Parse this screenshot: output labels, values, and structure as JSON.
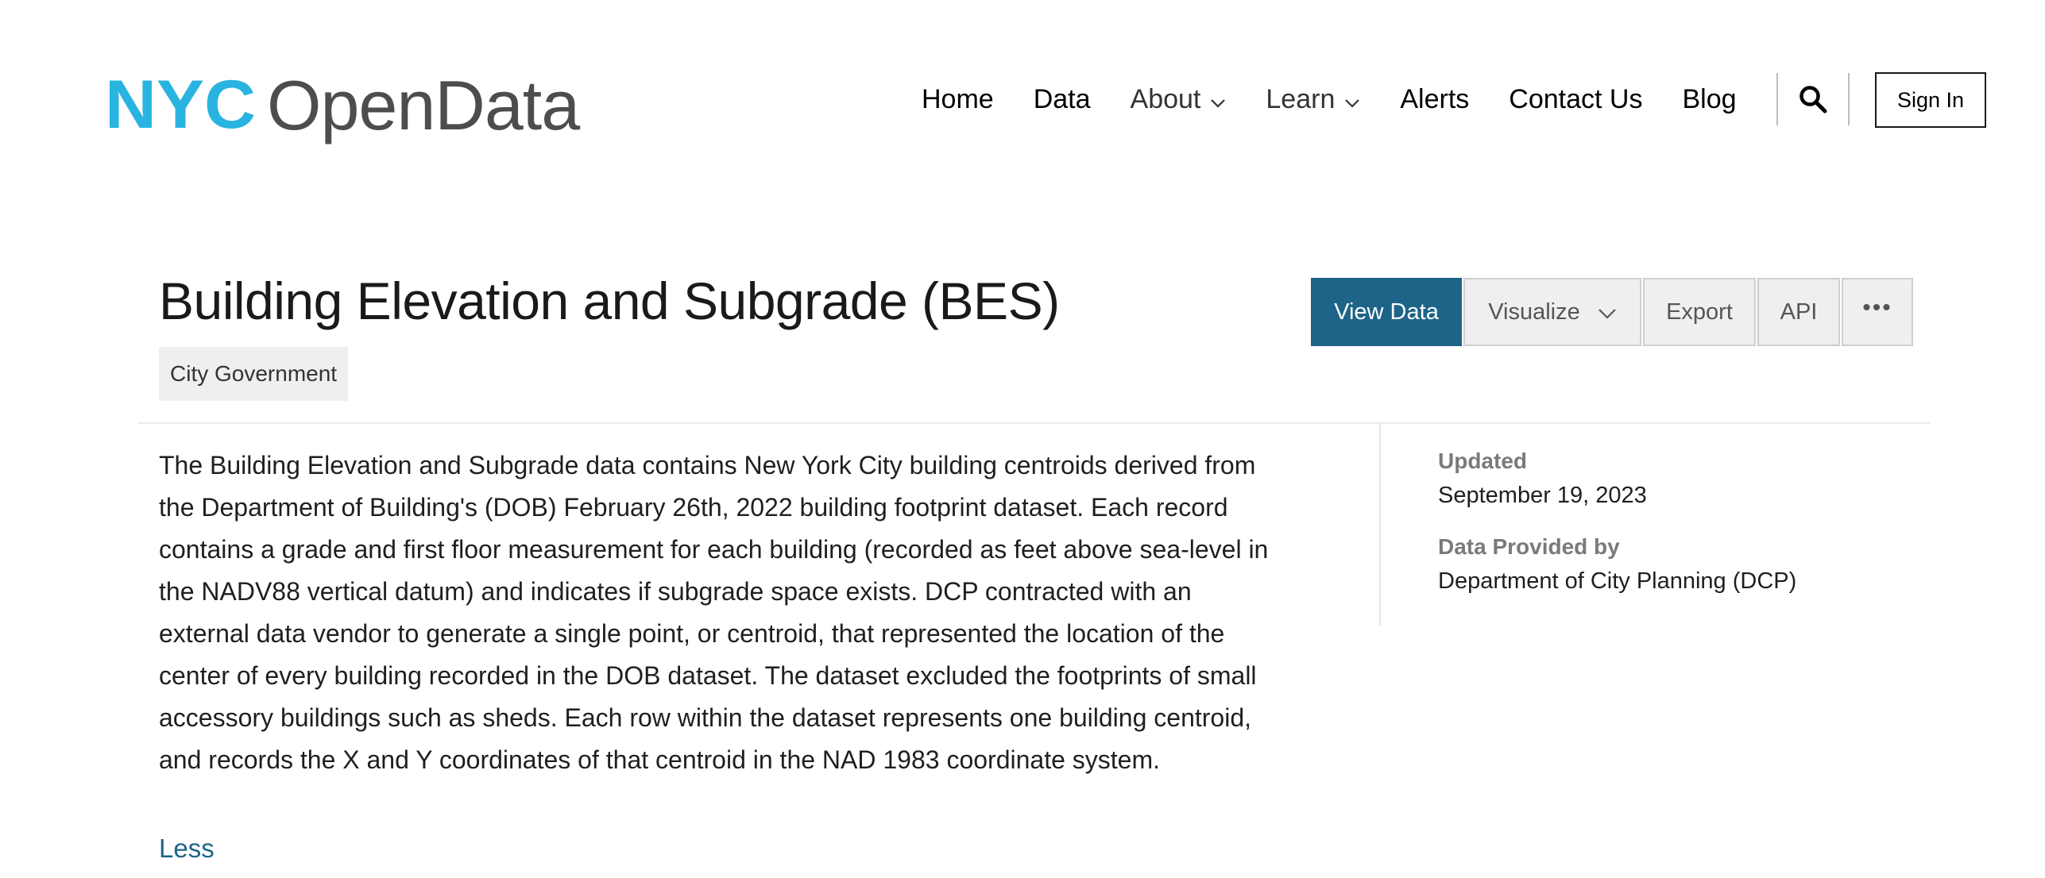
{
  "brand": {
    "logo_nyc_text": "NYC",
    "logo_text": "OpenData",
    "logo_color": "#29b3e0",
    "logo_text_color": "#4d4d4d"
  },
  "nav": {
    "items": [
      {
        "label": "Home",
        "has_dropdown": false
      },
      {
        "label": "Data",
        "has_dropdown": false
      },
      {
        "label": "About",
        "has_dropdown": true
      },
      {
        "label": "Learn",
        "has_dropdown": true
      },
      {
        "label": "Alerts",
        "has_dropdown": false
      },
      {
        "label": "Contact Us",
        "has_dropdown": false
      },
      {
        "label": "Blog",
        "has_dropdown": false
      }
    ],
    "search_icon": "search-icon",
    "sign_in_label": "Sign In"
  },
  "dataset": {
    "title": "Building Elevation and Subgrade (BES)",
    "category": "City Government",
    "description": "The Building Elevation and Subgrade data contains New York City building centroids derived from the Department of Building's (DOB) February 26th, 2022 building footprint dataset. Each record contains a grade and first floor measurement for each building (recorded as feet above sea-level in the NADV88 vertical datum) and indicates if subgrade space exists. DCP contracted with an external data vendor to generate a single point, or centroid, that represented the location of the center of every building recorded in the DOB dataset. The dataset excluded the footprints of small accessory buildings such as sheds. Each row within the dataset represents one building centroid, and records the X and Y coordinates of that centroid in the NAD 1983 coordinate system.",
    "less_label": "Less"
  },
  "actions": {
    "view_data": "View Data",
    "visualize": "Visualize",
    "export": "Export",
    "api": "API",
    "more": "•••",
    "primary_color": "#1e6388"
  },
  "metadata": {
    "updated_label": "Updated",
    "updated_value": "September 19, 2023",
    "provider_label": "Data Provided by",
    "provider_value": "Department of City Planning (DCP)"
  }
}
